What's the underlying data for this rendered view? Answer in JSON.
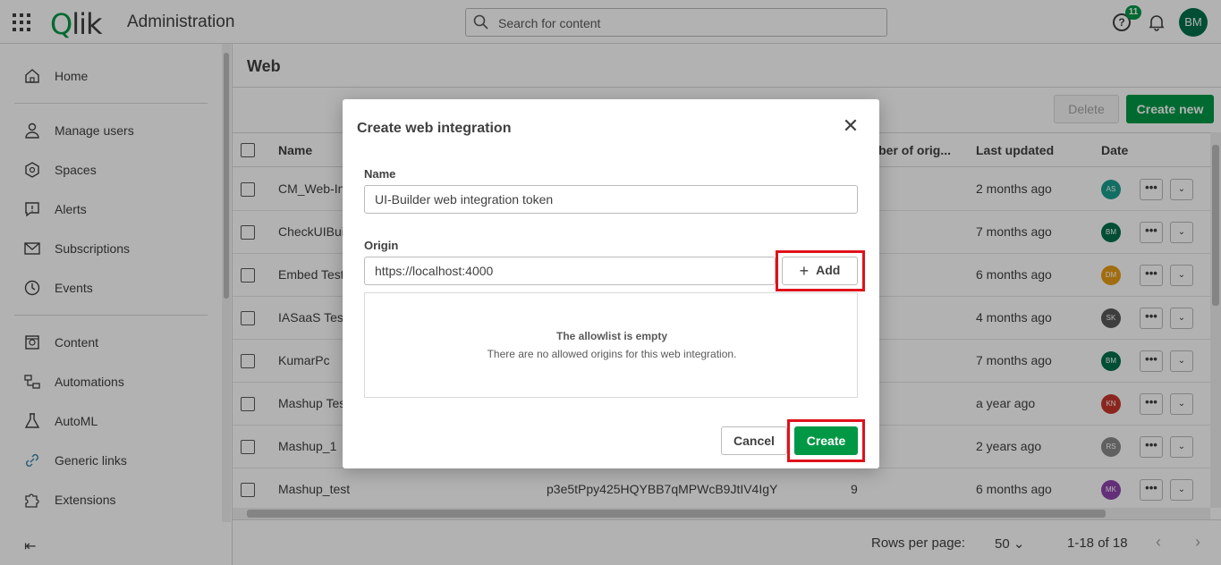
{
  "header": {
    "logo": "Qlik",
    "app_title": "Administration",
    "search_placeholder": "Search for content",
    "notification_count": "11",
    "user_initials": "BM"
  },
  "sidebar": {
    "items": [
      {
        "label": "Home",
        "icon": "home-icon"
      },
      {
        "label": "Manage users",
        "icon": "user-icon"
      },
      {
        "label": "Spaces",
        "icon": "spaces-icon"
      },
      {
        "label": "Alerts",
        "icon": "alert-icon"
      },
      {
        "label": "Subscriptions",
        "icon": "mail-icon"
      },
      {
        "label": "Events",
        "icon": "clock-icon"
      },
      {
        "label": "Content",
        "icon": "content-icon"
      },
      {
        "label": "Automations",
        "icon": "automation-icon"
      },
      {
        "label": "AutoML",
        "icon": "flask-icon"
      },
      {
        "label": "Generic links",
        "icon": "link-icon"
      },
      {
        "label": "Extensions",
        "icon": "puzzle-icon"
      }
    ]
  },
  "main": {
    "title": "Web",
    "delete_label": "Delete",
    "create_new_label": "Create new",
    "columns": {
      "name": "Name",
      "origins": "Number of orig...",
      "updated": "Last updated",
      "date": "Date"
    },
    "rows": [
      {
        "name": "CM_Web-Int",
        "id": "",
        "origins": "",
        "updated": "2 months ago",
        "owner": "AS",
        "owner_color": "#1a9e8f"
      },
      {
        "name": "CheckUIBuil",
        "id": "",
        "origins": "",
        "updated": "7 months ago",
        "owner": "BM",
        "owner_color": "#00704a"
      },
      {
        "name": "Embed Testi",
        "id": "",
        "origins": "",
        "updated": "6 months ago",
        "owner": "DM",
        "owner_color": "#e89c16"
      },
      {
        "name": "IASaaS Test",
        "id": "",
        "origins": "",
        "updated": "4 months ago",
        "owner": "SK",
        "owner_color": "#595959"
      },
      {
        "name": "KumarPc",
        "id": "",
        "origins": "",
        "updated": "7 months ago",
        "owner": "BM",
        "owner_color": "#00704a"
      },
      {
        "name": "Mashup Test",
        "id": "",
        "origins": "",
        "updated": "a year ago",
        "owner": "KN",
        "owner_color": "#c8372d"
      },
      {
        "name": "Mashup_1",
        "id": "",
        "origins": "",
        "updated": "2 years ago",
        "owner": "RS",
        "owner_color": "#8a8a8a"
      },
      {
        "name": "Mashup_test",
        "id": "p3e5tPpy425HQYBB7qMPWcB9JtIV4IgY",
        "origins": "9",
        "updated": "6 months ago",
        "owner": "MK",
        "owner_color": "#8e44ad"
      }
    ],
    "footer": {
      "rows_per_page_label": "Rows per page:",
      "rows_per_page_value": "50",
      "range": "1-18 of 18"
    }
  },
  "dialog": {
    "title": "Create web integration",
    "name_label": "Name",
    "name_value": "UI-Builder web integration token",
    "origin_label": "Origin",
    "origin_value": "https://localhost:4000",
    "add_label": "Add",
    "empty_title": "The allowlist is empty",
    "empty_sub": "There are no allowed origins for this web integration.",
    "cancel_label": "Cancel",
    "create_label": "Create"
  },
  "colors": {
    "brand_green": "#009845",
    "highlight_red": "#e0111b"
  }
}
